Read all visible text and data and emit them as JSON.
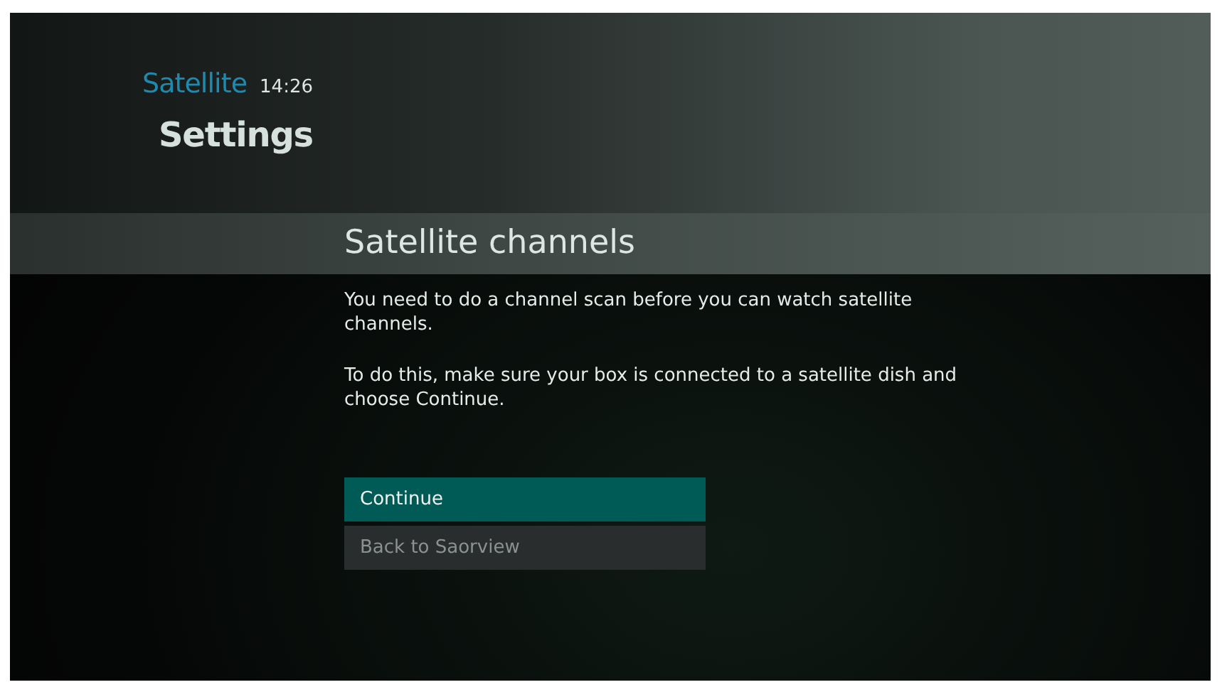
{
  "header": {
    "source": "Satellite",
    "time": "14:26",
    "title": "Settings"
  },
  "panel": {
    "heading": "Satellite channels",
    "paragraphs": [
      "You need to do a channel scan before you can watch satellite channels.",
      "To do this, make sure your box is connected to a satellite dish and choose Continue."
    ]
  },
  "options": [
    {
      "label": "Continue",
      "selected": true
    },
    {
      "label": "Back to Saorview",
      "selected": false
    }
  ]
}
